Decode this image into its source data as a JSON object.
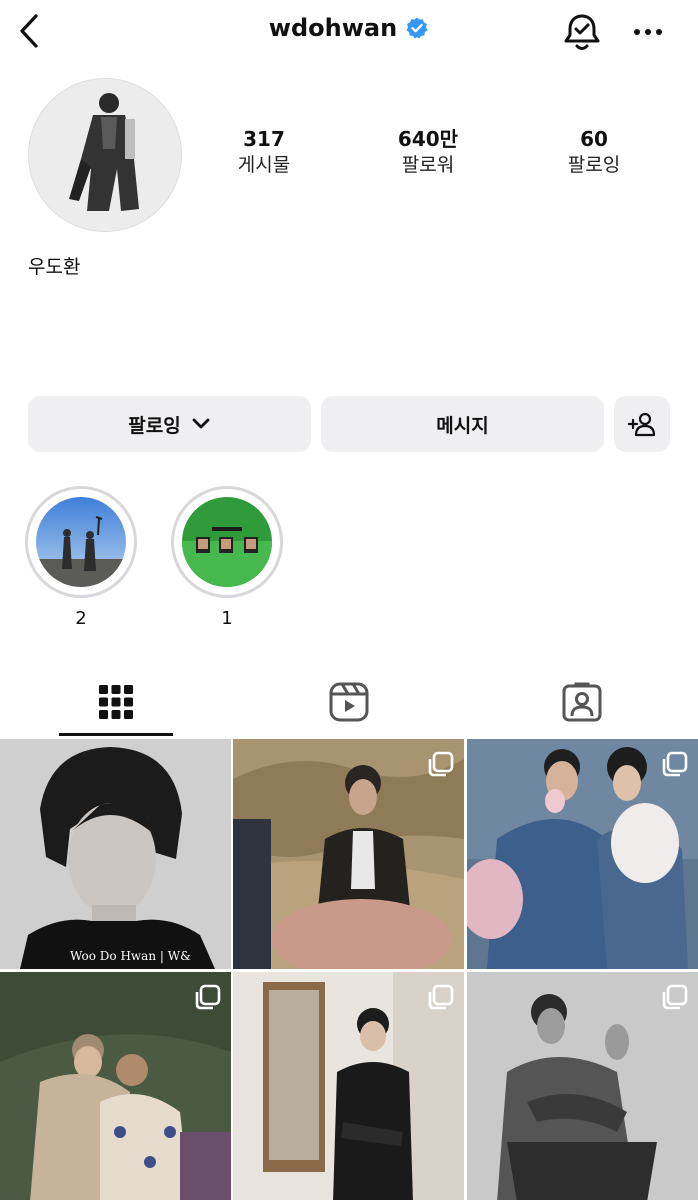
{
  "header": {
    "username": "wdohwan",
    "back_icon": "chevron-left-icon",
    "verified_icon": "verified-badge-icon",
    "bell_icon": "bell-check-icon",
    "more_icon": "more-horizontal-icon",
    "verified_color": "#3897f0"
  },
  "profile": {
    "display_name": "우도환",
    "stats": [
      {
        "value": "317",
        "label": "게시물"
      },
      {
        "value": "640만",
        "label": "팔로워"
      },
      {
        "value": "60",
        "label": "팔로잉"
      }
    ]
  },
  "actions": {
    "following_label": "팔로잉",
    "message_label": "메시지",
    "add_person_icon": "add-person-icon",
    "chevron_icon": "chevron-down-icon"
  },
  "highlights": [
    {
      "label": "2"
    },
    {
      "label": "1"
    }
  ],
  "tabs": [
    {
      "name": "grid",
      "icon": "grid-icon",
      "active": true
    },
    {
      "name": "reels",
      "icon": "reels-icon",
      "active": false
    },
    {
      "name": "tagged",
      "icon": "tagged-person-icon",
      "active": false
    }
  ],
  "posts": {
    "first_watermark": "Woo Do Hwan | W&"
  }
}
